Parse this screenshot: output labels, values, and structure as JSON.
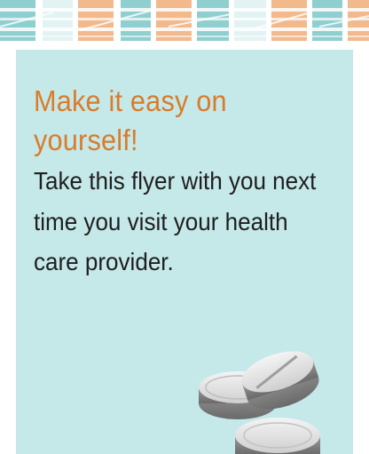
{
  "flyer": {
    "heading": "Make it easy on yourself!",
    "body": "Take this flyer with you next time you visit your health care provider."
  },
  "colors": {
    "heading": "#d97c2b",
    "panel": "#c5e8e9",
    "pattern_orange": "#f1b98c",
    "pattern_teal": "#8fcfcf",
    "pattern_light": "#e3f3f3"
  },
  "icons": [
    "pill-icon",
    "pill-icon",
    "pill-icon"
  ]
}
